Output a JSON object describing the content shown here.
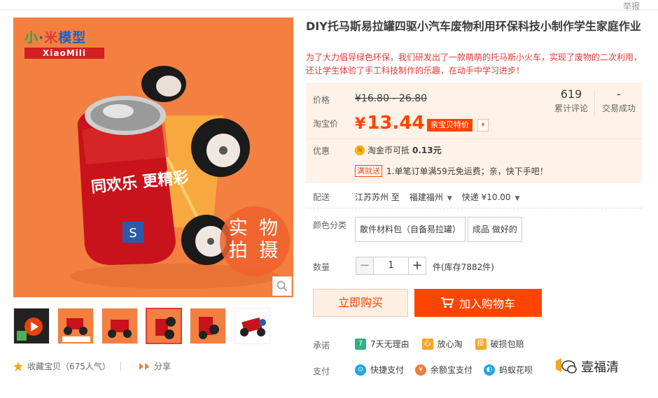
{
  "header": {
    "report_label": "举报"
  },
  "gallery": {
    "logo_cn": [
      "小",
      "·",
      "米",
      "模型"
    ],
    "logo_en": "XiaoMili",
    "stamp_line1": "实 物",
    "stamp_line2": "拍 摄",
    "can_text": "同欢乐 更精彩"
  },
  "product": {
    "title": "DIY托马斯易拉罐四驱小汽车废物利用环保科技小制作学生家庭作业",
    "subtitle": "为了大力倡导绿色环保，我们研发出了一款萌萌的托马斯小火车，实现了废物的二次利用，还让学生体验了手工科技制作的乐趣，在动手中学习进步！"
  },
  "price": {
    "price_label": "价格",
    "original": "¥16.80 - 26.80",
    "taobao_label": "淘宝价",
    "currency": "¥",
    "current": "13.44",
    "promo_tag": "亲宝贝特价",
    "reviews_count": "619",
    "reviews_label": "累计评论",
    "deals_count": "-",
    "deals_label": "交易成功",
    "discount_label": "优惠",
    "coin_icon_text": "淘",
    "coin_text_prefix": "淘金币可抵",
    "coin_amount": "0.13元",
    "shipping_tag": "满就送",
    "shipping_text": "1.单笔订单满59元免运费；亲，快下手吧！"
  },
  "delivery": {
    "label": "配送",
    "from": "江苏苏州 至",
    "to": "福建福州",
    "method": "快递 ¥10.00"
  },
  "sku": {
    "label": "颜色分类",
    "options": [
      "散件材料包（自备易拉罐）",
      "成品 做好的"
    ]
  },
  "quantity": {
    "label": "数量",
    "value": "1",
    "minus": "−",
    "plus": "+",
    "stock": "件(库存7882件)"
  },
  "actions": {
    "buy_now": "立即购买",
    "add_to_cart": "加入购物车"
  },
  "promise": {
    "label": "承诺",
    "items": [
      {
        "icon": "7",
        "text": "7天无理由",
        "color": "#2fb27b"
      },
      {
        "icon": "心",
        "text": "放心淘",
        "color": "#f5a623"
      },
      {
        "icon": "损",
        "text": "破损包赔",
        "color": "#f5a623"
      }
    ]
  },
  "payment": {
    "label": "支付",
    "items": [
      {
        "icon": "⊙",
        "text": "快捷支付",
        "color": "#1ba7e4"
      },
      {
        "icon": "¥",
        "text": "余额宝支付",
        "color": "#f07a3c"
      },
      {
        "icon": "◐",
        "text": "蚂蚁花呗",
        "color": "#1ba7e4"
      }
    ]
  },
  "footer": {
    "favorite": "收藏宝贝（675人气）",
    "share": "分享",
    "watermark": "壹福清"
  }
}
